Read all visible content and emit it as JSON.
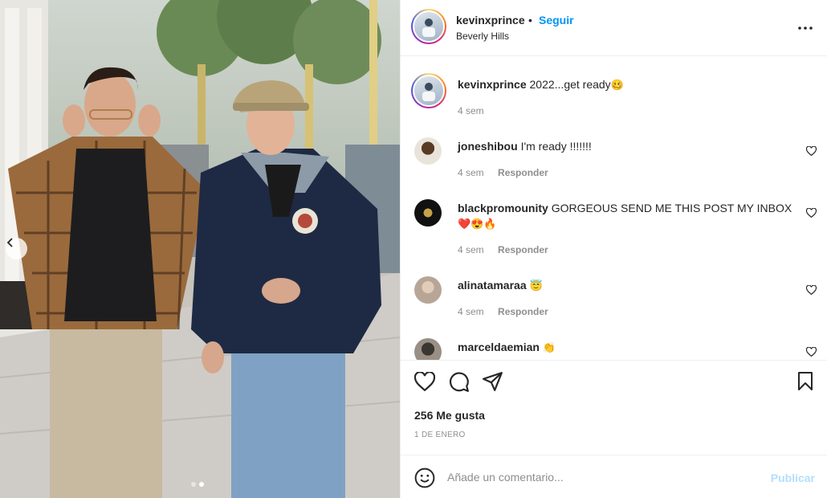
{
  "post": {
    "username": "kevinxprince",
    "separator": "•",
    "follow_label": "Seguir",
    "location": "Beverly Hills",
    "more_icon": "more-horizontal-icon"
  },
  "photo": {
    "carousel_total": 2,
    "carousel_active": 2,
    "prev_icon": "chevron-left-icon"
  },
  "caption": {
    "username": "kevinxprince",
    "text": "2022...get ready",
    "emoji": "🥴",
    "time": "4 sem"
  },
  "comments": [
    {
      "username": "joneshibou",
      "text": "I'm ready !!!!!!!",
      "emoji": "",
      "time": "4 sem",
      "reply_label": "Responder"
    },
    {
      "username": "blackpromounity",
      "text": "GORGEOUS SEND ME THIS POST MY INBOX",
      "emoji": "❤️😍🔥",
      "time": "4 sem",
      "reply_label": "Responder"
    },
    {
      "username": "alinatamaraa",
      "text": "",
      "emoji": "😇",
      "time": "4 sem",
      "reply_label": "Responder"
    },
    {
      "username": "marceldaemian",
      "text": "",
      "emoji": "👏",
      "time": "",
      "reply_label": ""
    }
  ],
  "actions": {
    "icons": [
      "heart-icon",
      "comment-icon",
      "share-icon",
      "bookmark-icon"
    ],
    "likes": "256 Me gusta",
    "date": "1 DE ENERO"
  },
  "composer": {
    "placeholder": "Añade un comentario...",
    "publish_label": "Publicar",
    "emoji_icon": "smiley-icon"
  },
  "colors": {
    "accent": "#0095f6",
    "publish_disabled": "#b2dffc",
    "muted": "#8e8e8e"
  }
}
